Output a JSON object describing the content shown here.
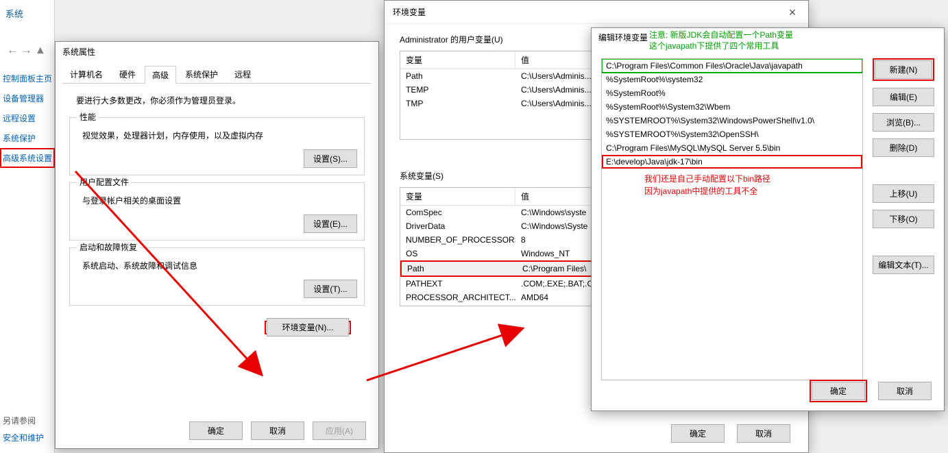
{
  "system_panel": {
    "title": "系统",
    "nav": [
      "控制面板主页",
      "设备管理器",
      "远程设置",
      "系统保护",
      "高级系统设置"
    ],
    "bottom": [
      "另请参阅",
      "安全和维护"
    ]
  },
  "sysprops": {
    "title": "系统属性",
    "tabs": {
      "computer": "计算机名",
      "hardware": "硬件",
      "advanced": "高级",
      "protect": "系统保护",
      "remote": "远程"
    },
    "note": "要进行大多数更改，你必须作为管理员登录。",
    "perf": {
      "title": "性能",
      "text": "视觉效果，处理器计划，内存使用，以及虚拟内存",
      "btn": "设置(S)..."
    },
    "profiles": {
      "title": "用户配置文件",
      "text": "与登录帐户相关的桌面设置",
      "btn": "设置(E)..."
    },
    "startup": {
      "title": "启动和故障恢复",
      "text": "系统启动、系统故障和调试信息",
      "btn": "设置(T)..."
    },
    "env_btn": "环境变量(N)...",
    "ok": "确定",
    "cancel": "取消",
    "apply": "应用(A)"
  },
  "envvars": {
    "title": "环境变量",
    "user_title": "Administrator 的用户变量(U)",
    "col_var": "变量",
    "col_val": "值",
    "user_rows": [
      {
        "var": "Path",
        "val": "C:\\Users\\Adminis..."
      },
      {
        "var": "TEMP",
        "val": "C:\\Users\\Adminis..."
      },
      {
        "var": "TMP",
        "val": "C:\\Users\\Adminis..."
      }
    ],
    "sys_title": "系统变量(S)",
    "sys_rows": [
      {
        "var": "ComSpec",
        "val": "C:\\Windows\\syste"
      },
      {
        "var": "DriverData",
        "val": "C:\\Windows\\Syste"
      },
      {
        "var": "NUMBER_OF_PROCESSORS",
        "val": "8"
      },
      {
        "var": "OS",
        "val": "Windows_NT"
      },
      {
        "var": "Path",
        "val": "C:\\Program Files\\"
      },
      {
        "var": "PATHEXT",
        "val": ".COM;.EXE;.BAT;.C"
      },
      {
        "var": "PROCESSOR_ARCHITECT...",
        "val": "AMD64"
      }
    ],
    "ok": "确定",
    "cancel": "取消"
  },
  "editpath": {
    "title": "编辑环境变量",
    "green_note_1": "注意: 新版JDK会自动配置一个Path变量",
    "green_note_2": "这个javapath下提供了四个常用工具",
    "items": [
      "C:\\Program Files\\Common Files\\Oracle\\Java\\javapath",
      "%SystemRoot%\\system32",
      "%SystemRoot%",
      "%SystemRoot%\\System32\\Wbem",
      "%SYSTEMROOT%\\System32\\WindowsPowerShell\\v1.0\\",
      "%SYSTEMROOT%\\System32\\OpenSSH\\",
      "C:\\Program Files\\MySQL\\MySQL Server 5.5\\bin",
      "E:\\develop\\Java\\jdk-17\\bin"
    ],
    "red_note_1": "我们还是自己手动配置以下bin路径",
    "red_note_2": "因为javapath中提供的工具不全",
    "btn_new": "新建(N)",
    "btn_edit": "编辑(E)",
    "btn_browse": "浏览(B)...",
    "btn_del": "删除(D)",
    "btn_up": "上移(U)",
    "btn_down": "下移(O)",
    "btn_text": "编辑文本(T)...",
    "ok": "确定",
    "cancel": "取消"
  }
}
